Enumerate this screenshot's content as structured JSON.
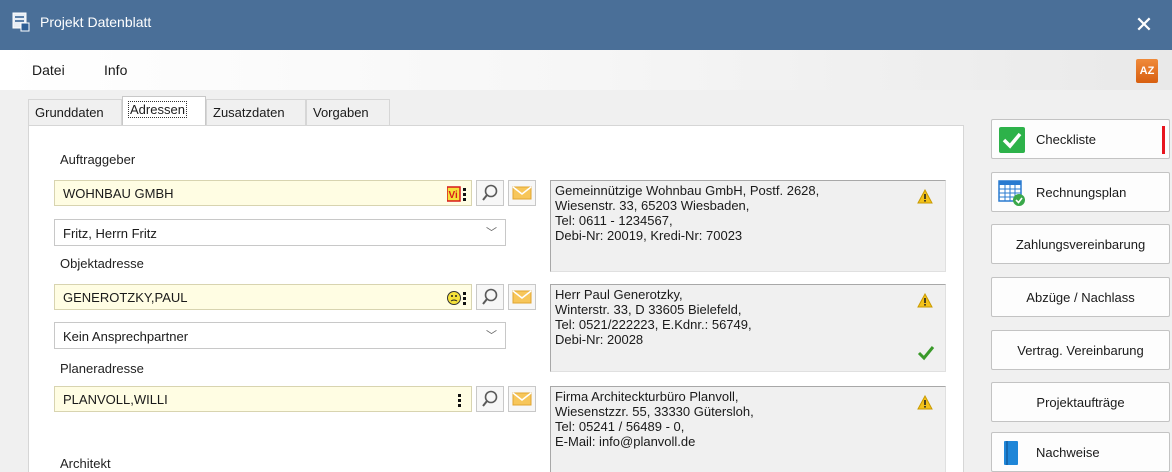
{
  "window": {
    "title": "Projekt Datenblatt",
    "close_glyph": "✕"
  },
  "menu": {
    "items": [
      "Datei",
      "Info"
    ],
    "az_icon_text": "AZ"
  },
  "tabs": [
    "Grunddaten",
    "Adressen",
    "Zusatzdaten",
    "Vorgaben"
  ],
  "active_tab": "Adressen",
  "sections": {
    "auftraggeber": {
      "label": "Auftraggeber",
      "value": "WOHNBAU GMBH",
      "marker_text": "Vi",
      "contact": "Fritz, Herrn Fritz",
      "info": [
        "Gemeinnützige Wohnbau GmbH, Postf. 2628,",
        "Wiesenstr. 33, 65203 Wiesbaden,",
        "Tel: 0611 - 1234567,",
        "Debi-Nr: 20019, Kredi-Nr: 70023"
      ]
    },
    "objektadresse": {
      "label": "Objektadresse",
      "value": "GENEROTZKY,PAUL",
      "contact": "Kein Ansprechpartner",
      "info": [
        "Herr Paul Generotzky,",
        "Winterstr. 33, D 33605 Bielefeld,",
        "Tel: 0521/222223, E.Kdnr.: 56749,",
        "Debi-Nr: 20028"
      ]
    },
    "planeradresse": {
      "label": "Planeradresse",
      "value": "PLANVOLL,WILLI",
      "info": [
        "Firma Architeckturbüro Planvoll,",
        "Wiesenstzzr. 55, 33330 Gütersloh,",
        "Tel: 05241 / 56489 - 0,",
        "E-Mail: info@planvoll.de"
      ]
    },
    "architekt": {
      "label": "Architekt"
    }
  },
  "side_buttons": [
    "Checkliste",
    "Rechnungsplan",
    "Zahlungsvereinbarung",
    "Abzüge / Nachlass",
    "Vertrag. Vereinbarung",
    "Projektaufträge",
    "Nachweise"
  ],
  "colors": {
    "titlebar": "#4a6f98",
    "field_bg": "#fffde3",
    "checklist_green": "#2db24a",
    "warning": "#f3c21a",
    "ok_check": "#3a9a2a",
    "red_mark": "#e8141e"
  }
}
